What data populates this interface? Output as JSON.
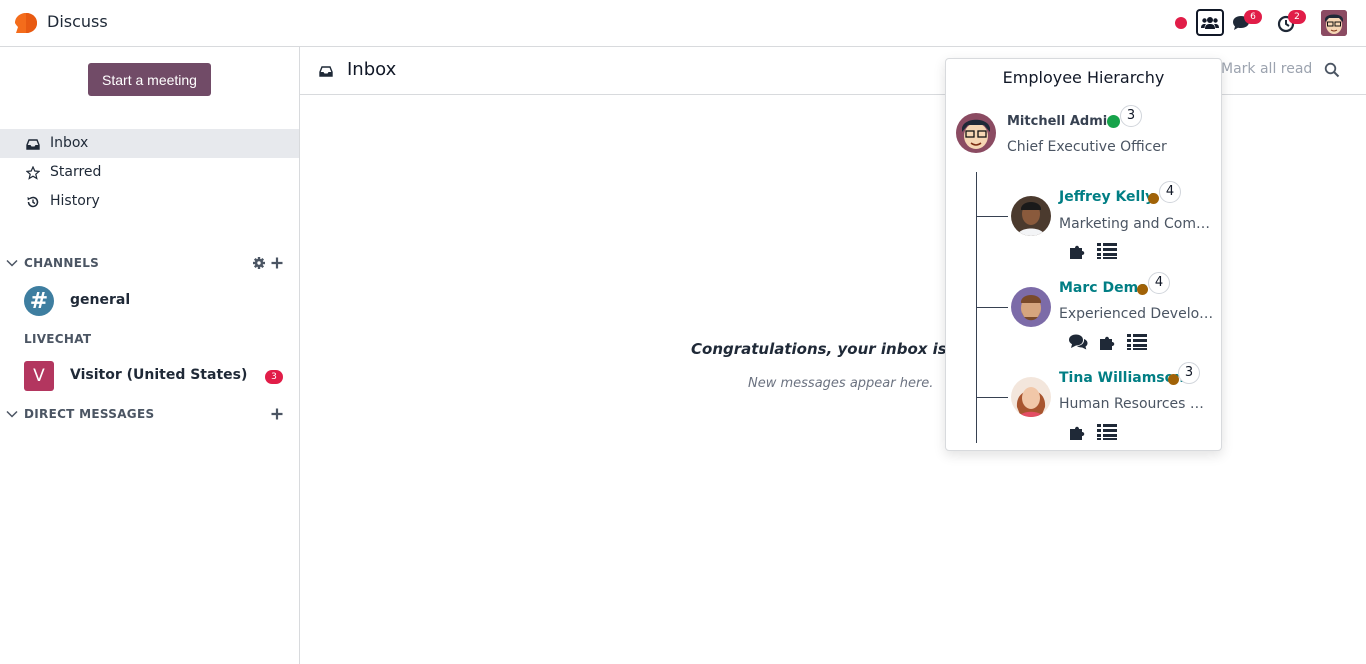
{
  "app": {
    "title": "Discuss",
    "logo_color": "#f46c1b"
  },
  "navbar": {
    "status_color": "#e11d48",
    "messages_badge": "6",
    "activities_badge": "2"
  },
  "sidebar": {
    "start_meeting_label": "Start a meeting",
    "mailboxes": [
      {
        "label": "Inbox",
        "icon": "inbox-icon"
      },
      {
        "label": "Starred",
        "icon": "star-icon"
      },
      {
        "label": "History",
        "icon": "history-icon"
      }
    ],
    "channels_header": "CHANNELS",
    "channels": [
      {
        "name": "general",
        "avatar": "#"
      }
    ],
    "livechat_header": "LIVECHAT",
    "livechats": [
      {
        "name": "Visitor (United States)",
        "avatar": "V",
        "count": "3"
      }
    ],
    "dm_header": "DIRECT MESSAGES"
  },
  "main": {
    "title": "Inbox",
    "mark_all_read": "Mark all read",
    "empty_title": "Congratulations, your inbox is en",
    "empty_subtitle": "New messages appear here."
  },
  "hierarchy": {
    "title": "Employee Hierarchy",
    "manager": {
      "name": "Mitchell Admin",
      "job": "Chief Executive Officer",
      "count": "3",
      "status_color": "#16a34a"
    },
    "reports": [
      {
        "name": "Jeffrey Kelly",
        "job": "Marketing and Comm…",
        "count": "4",
        "status_color": "#a16207",
        "actions": [
          "puzzle-icon",
          "list-icon"
        ]
      },
      {
        "name": "Marc Demo",
        "job": "Experienced Developer",
        "count": "4",
        "status_color": "#a16207",
        "actions": [
          "chat-icon",
          "puzzle-icon",
          "list-icon"
        ]
      },
      {
        "name": "Tina Williamson",
        "job": "Human Resources M…",
        "count": "3",
        "status_color": "#a16207",
        "actions": [
          "puzzle-icon",
          "list-icon"
        ]
      }
    ],
    "name_color": "#017e84"
  }
}
